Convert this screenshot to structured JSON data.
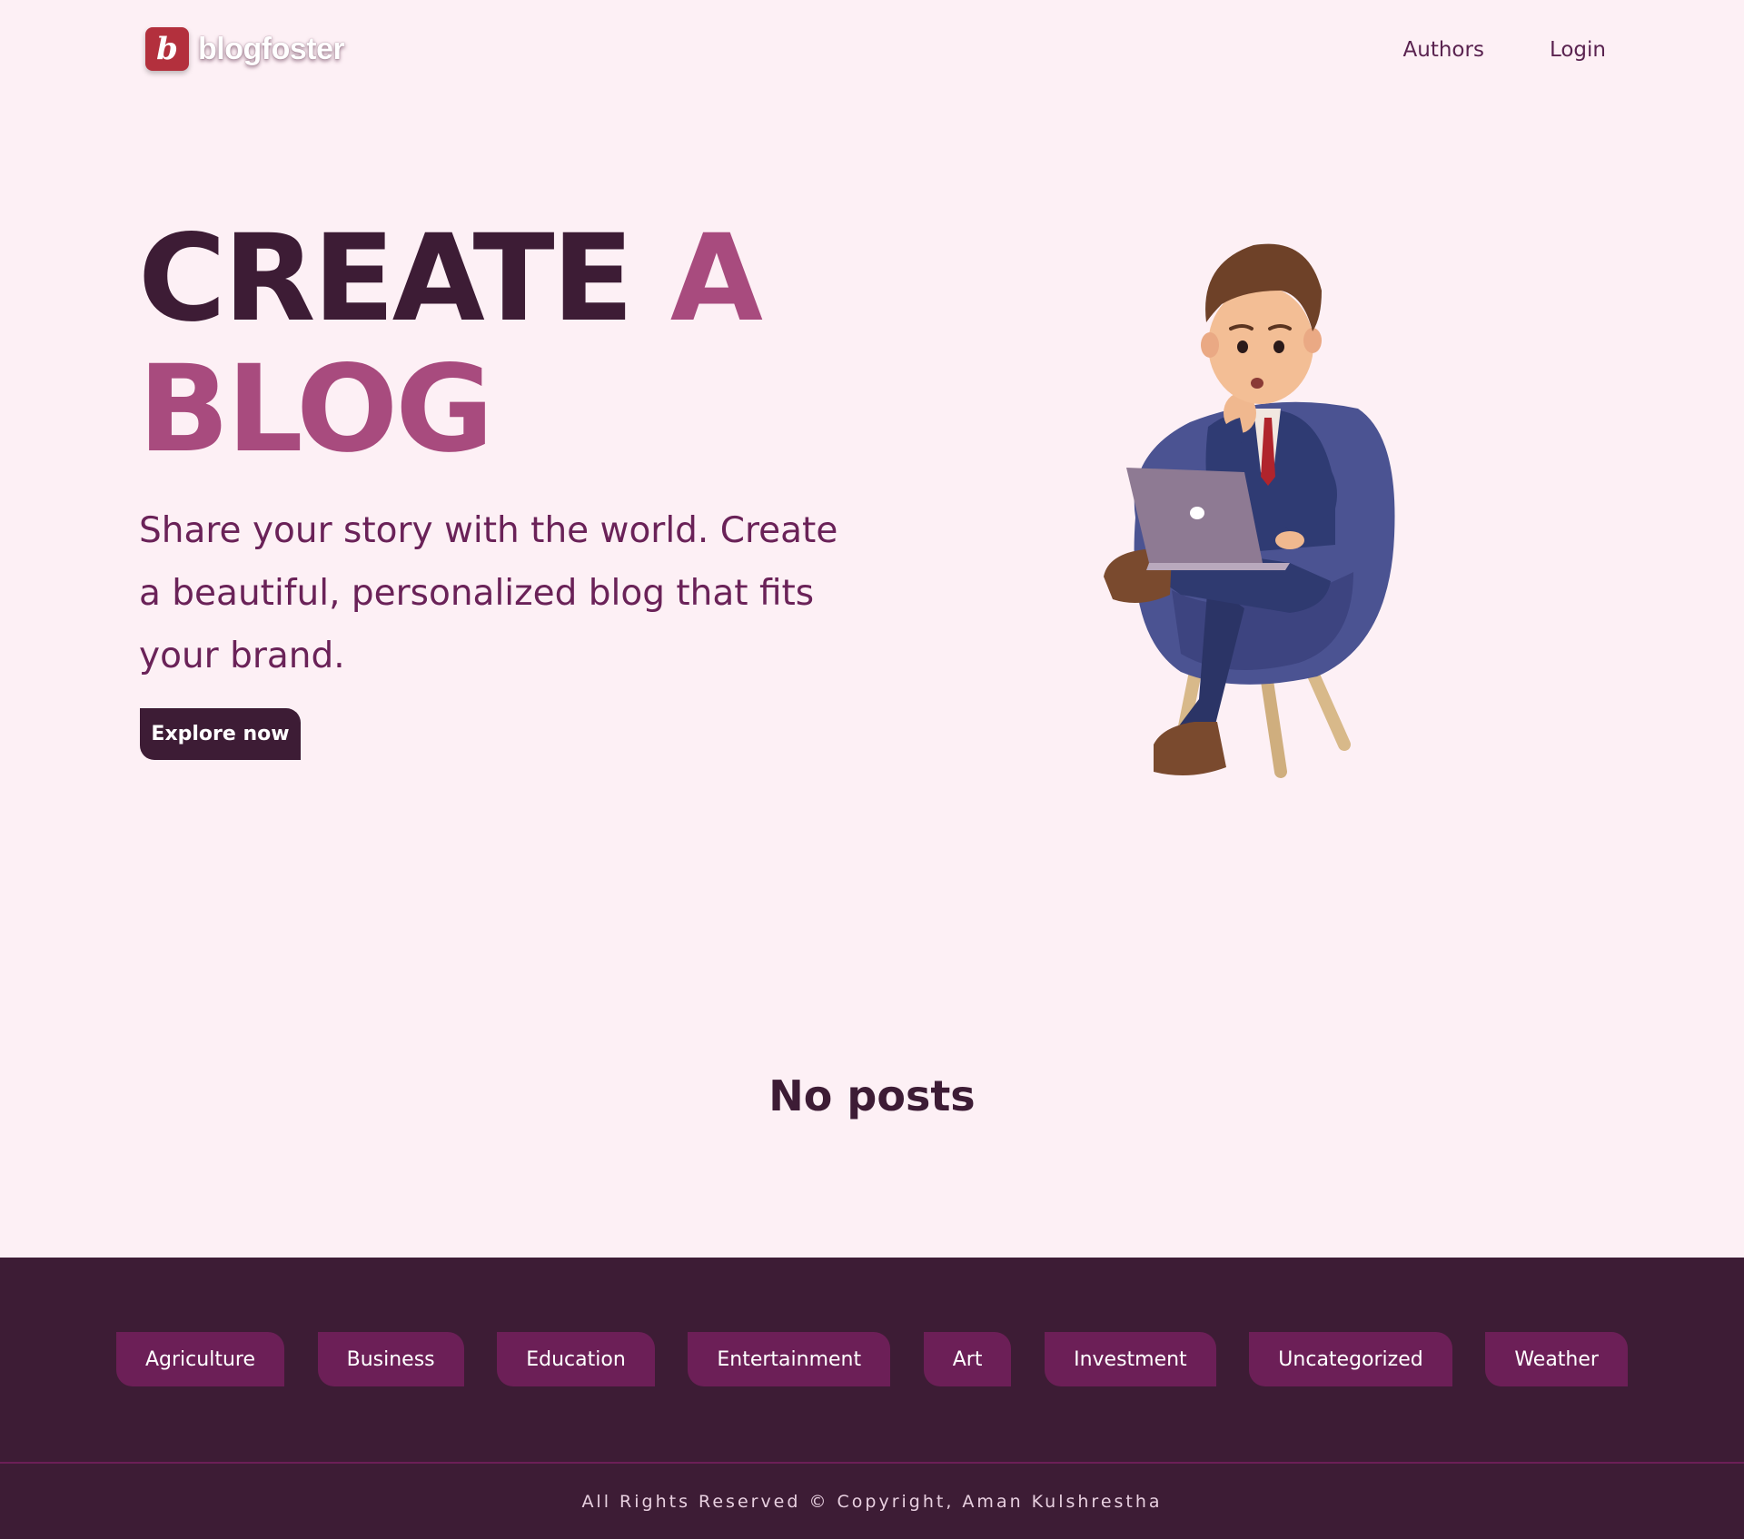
{
  "header": {
    "logo_letter": "b",
    "logo_text": "blogfoster",
    "nav": [
      {
        "label": "Authors"
      },
      {
        "label": "Login"
      }
    ]
  },
  "hero": {
    "title_part1": "CREATE",
    "title_part2": "A",
    "title_part3": "BLOG",
    "description": "Share your story with the world. Create a beautiful, personalized blog that fits your brand.",
    "cta_label": "Explore now",
    "illustration": "businessman-on-chair-with-laptop"
  },
  "main": {
    "empty_state": "No posts"
  },
  "footer": {
    "categories": [
      "Agriculture",
      "Business",
      "Education",
      "Entertainment",
      "Art",
      "Investment",
      "Uncategorized",
      "Weather"
    ],
    "copyright": "All Rights Reserved © Copyright, Aman Kulshrestha"
  },
  "colors": {
    "background": "#fdf0f5",
    "primary_dark": "#3d1c35",
    "accent": "#a84b7e",
    "chip": "#6c1f57",
    "logo": "#b3303d"
  }
}
